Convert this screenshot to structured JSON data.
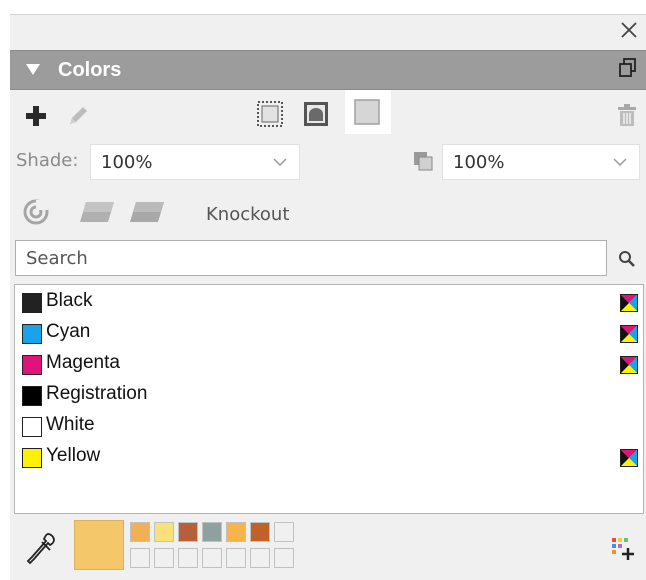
{
  "panel": {
    "title": "Colors"
  },
  "toolbar": {
    "icons": [
      "plus-icon",
      "pencil-icon",
      "frame-icon",
      "picture-icon",
      "text-icon",
      "trash-icon"
    ]
  },
  "shade": {
    "label": "Shade:",
    "value": "100%"
  },
  "opacity": {
    "value": "100%"
  },
  "knockout": {
    "label": "Knockout"
  },
  "search": {
    "placeholder": "Search"
  },
  "colors_list": [
    {
      "name": "Black",
      "swatch": "#222222",
      "cmyk": true
    },
    {
      "name": "Cyan",
      "swatch": "#1aa3e8",
      "cmyk": true
    },
    {
      "name": "Magenta",
      "swatch": "#e0137b",
      "cmyk": true
    },
    {
      "name": "Registration",
      "swatch": "#000000",
      "cmyk": false
    },
    {
      "name": "White",
      "swatch": "#ffffff",
      "cmyk": false
    },
    {
      "name": "Yellow",
      "swatch": "#fff200",
      "cmyk": true
    }
  ],
  "recent_colors": {
    "current": "#f5c76b",
    "row1": [
      "#f0b055",
      "#f8e07a",
      "#b5603a",
      "#8fa0a0",
      "#f8b44a",
      "#c0602a",
      "#f0f0f0"
    ],
    "row2": [
      "#f0f0f0",
      "#f0f0f0",
      "#f0f0f0",
      "#f0f0f0",
      "#f0f0f0",
      "#f0f0f0",
      "#f0f0f0"
    ]
  }
}
